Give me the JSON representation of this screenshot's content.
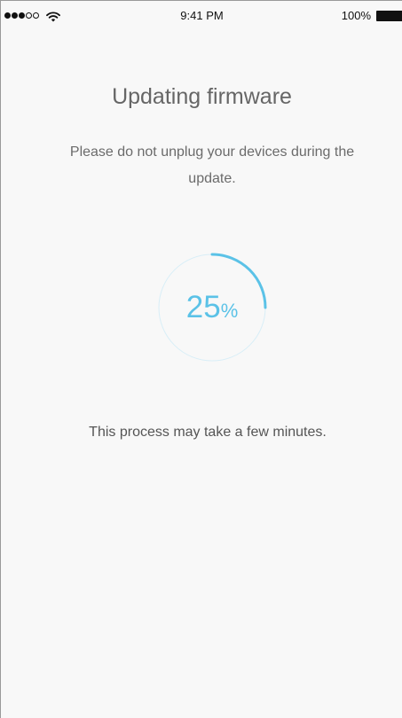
{
  "status_bar": {
    "time": "9:41 PM",
    "battery_percent": "100%",
    "signal_bars_filled": 3,
    "signal_bars_total": 5,
    "signal_icon": "signal-dots-icon",
    "wifi_icon": "wifi-icon",
    "battery_icon": "battery-icon"
  },
  "screen": {
    "title": "Updating firmware",
    "subtitle": "Please do not unplug your devices during the update.",
    "progress": {
      "number": "25",
      "unit": "%",
      "fraction": 0.25
    },
    "note": "This process may take a few minutes."
  },
  "colors": {
    "accent": "#5bc2e7",
    "track": "#d8eef7",
    "background": "#f8f8f8",
    "text": "#666666"
  }
}
